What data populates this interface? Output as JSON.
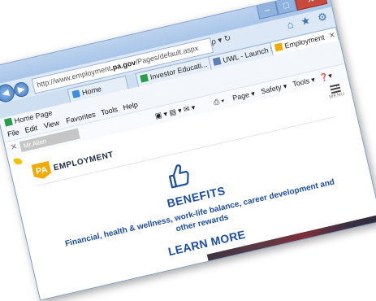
{
  "caption": {
    "buttons": [
      "–",
      "□",
      "✕"
    ]
  },
  "address": {
    "url_prefix": "http://www.employment",
    "url_host": ".pa.gov",
    "url_path": "/Pages/default.aspx",
    "tools": "ρ ▾ ↻",
    "right_icons": [
      "⌂",
      "★",
      "⚙"
    ]
  },
  "tabs": [
    {
      "label": "Home",
      "icon": "ie-icon"
    },
    {
      "label": "Investor Educati...",
      "icon": "green-icon"
    },
    {
      "label": "UWL - Launch S...",
      "icon": "uwl-icon"
    },
    {
      "label": "Employment",
      "icon": "pa-icon",
      "close": "✕"
    }
  ],
  "favorites": [
    {
      "label": "Home Page",
      "icon": "green-icon"
    }
  ],
  "menu": [
    "File",
    "Edit",
    "View",
    "Favorites",
    "Tools",
    "Help"
  ],
  "command_bar": {
    "profile": "Mr.Allen",
    "items": [
      "Page ▾",
      "Safety ▾",
      "Tools ▾",
      "❓▾"
    ],
    "menu_label": "MENU"
  },
  "page": {
    "brand": {
      "logo": "PA",
      "name": "EMPLOYMENT"
    },
    "headline": "BENEFITS",
    "description": "Financial, health & wellness, work-life balance, career development and other rewards",
    "cta": "LEARN MORE"
  }
}
